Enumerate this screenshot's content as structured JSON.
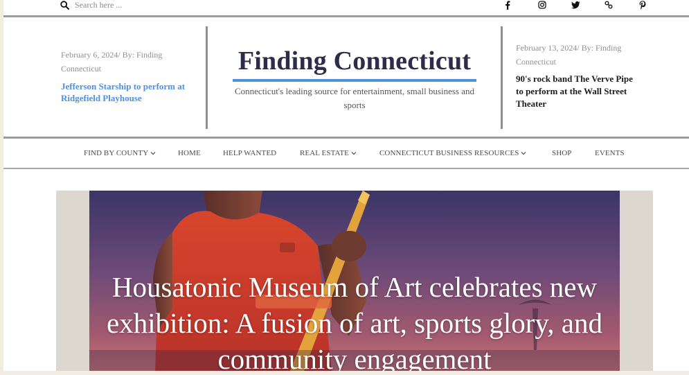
{
  "search": {
    "placeholder": "Search here ..."
  },
  "socials": [
    {
      "icon": "facebook-icon"
    },
    {
      "icon": "instagram-icon"
    },
    {
      "icon": "twitter-icon"
    },
    {
      "icon": "link-icon"
    },
    {
      "icon": "pinterest-icon"
    }
  ],
  "header": {
    "left_post": {
      "meta": "February 6, 2024/ By: Finding Connecticut",
      "headline": "Jefferson Starship to perform at Ridgefield Playhouse"
    },
    "site_title": "Finding Connecticut",
    "tagline": "Connecticut's leading source for entertainment, small business and sports",
    "right_post": {
      "meta": "February 13, 2024/ By: Finding Connecticut",
      "headline": "90's rock band The Verve Pipe to perform at the Wall Street Theater"
    }
  },
  "nav": {
    "items": [
      {
        "label": "FIND BY COUNTY",
        "dropdown": true
      },
      {
        "label": "HOME",
        "dropdown": false
      },
      {
        "label": "HELP WANTED",
        "dropdown": false
      },
      {
        "label": "REAL ESTATE",
        "dropdown": true
      },
      {
        "label": "CONNECTICUT BUSINESS RESOURCES",
        "dropdown": true
      },
      {
        "label": "SHOP",
        "dropdown": false
      },
      {
        "label": "EVENTS",
        "dropdown": false
      }
    ]
  },
  "hero": {
    "title": "Housatonic Museum of Art celebrates new exhibition: A fusion of art, sports glory, and community engagement"
  },
  "colors": {
    "accent": "#4f8fe3",
    "title": "#2d2c4a",
    "divider": "#8e8e8e"
  }
}
